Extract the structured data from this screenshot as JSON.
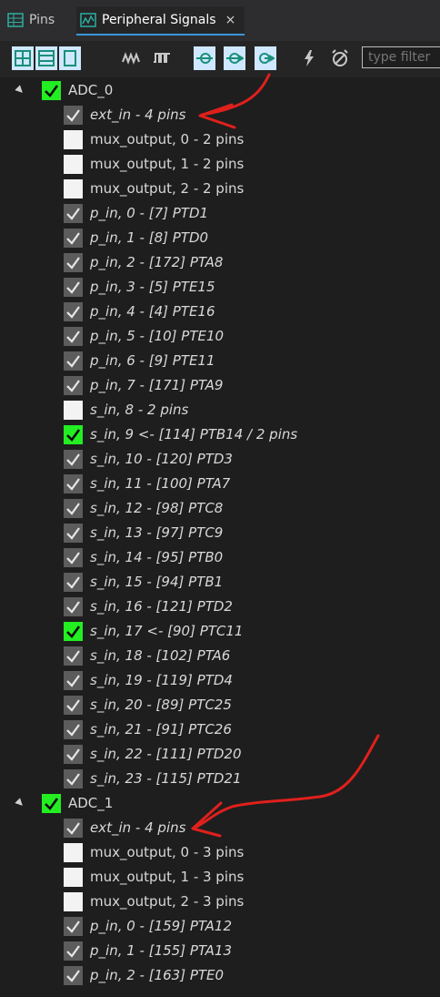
{
  "tabs": [
    {
      "label": "Pins"
    },
    {
      "label": "Peripheral Signals"
    }
  ],
  "toolbar": {
    "filter_placeholder": "type filter"
  },
  "tree": [
    {
      "name": "ADC_0",
      "items": [
        {
          "label": "ext_in - 4 pins",
          "state": "checked",
          "italic": true
        },
        {
          "label": "mux_output, 0 - 2 pins",
          "state": "unchecked",
          "italic": false
        },
        {
          "label": "mux_output, 1 - 2 pins",
          "state": "unchecked",
          "italic": false
        },
        {
          "label": "mux_output, 2 - 2 pins",
          "state": "unchecked",
          "italic": false
        },
        {
          "label": "p_in, 0 - [7] PTD1",
          "state": "checked",
          "italic": true
        },
        {
          "label": "p_in, 1 - [8] PTD0",
          "state": "checked",
          "italic": true
        },
        {
          "label": "p_in, 2 - [172] PTA8",
          "state": "checked",
          "italic": true
        },
        {
          "label": "p_in, 3 - [5] PTE15",
          "state": "checked",
          "italic": true
        },
        {
          "label": "p_in, 4 - [4] PTE16",
          "state": "checked",
          "italic": true
        },
        {
          "label": "p_in, 5 - [10] PTE10",
          "state": "checked",
          "italic": true
        },
        {
          "label": "p_in, 6 - [9] PTE11",
          "state": "checked",
          "italic": true
        },
        {
          "label": "p_in, 7 - [171] PTA9",
          "state": "checked",
          "italic": true
        },
        {
          "label": "s_in, 8 - 2 pins",
          "state": "unchecked",
          "italic": true
        },
        {
          "label": "s_in, 9 <- [114] PTB14 / 2 pins",
          "state": "green",
          "italic": true
        },
        {
          "label": "s_in, 10 - [120] PTD3",
          "state": "checked",
          "italic": true
        },
        {
          "label": "s_in, 11 - [100] PTA7",
          "state": "checked",
          "italic": true
        },
        {
          "label": "s_in, 12 - [98] PTC8",
          "state": "checked",
          "italic": true
        },
        {
          "label": "s_in, 13 - [97] PTC9",
          "state": "checked",
          "italic": true
        },
        {
          "label": "s_in, 14 - [95] PTB0",
          "state": "checked",
          "italic": true
        },
        {
          "label": "s_in, 15 - [94] PTB1",
          "state": "checked",
          "italic": true
        },
        {
          "label": "s_in, 16 - [121] PTD2",
          "state": "checked",
          "italic": true
        },
        {
          "label": "s_in, 17 <- [90] PTC11",
          "state": "green",
          "italic": true
        },
        {
          "label": "s_in, 18 - [102] PTA6",
          "state": "checked",
          "italic": true
        },
        {
          "label": "s_in, 19 - [119] PTD4",
          "state": "checked",
          "italic": true
        },
        {
          "label": "s_in, 20 - [89] PTC25",
          "state": "checked",
          "italic": true
        },
        {
          "label": "s_in, 21 - [91] PTC26",
          "state": "checked",
          "italic": true
        },
        {
          "label": "s_in, 22 - [111] PTD20",
          "state": "checked",
          "italic": true
        },
        {
          "label": "s_in, 23 - [115] PTD21",
          "state": "checked",
          "italic": true
        }
      ]
    },
    {
      "name": "ADC_1",
      "items": [
        {
          "label": "ext_in - 4 pins",
          "state": "checked",
          "italic": true
        },
        {
          "label": "mux_output, 0 - 3 pins",
          "state": "unchecked",
          "italic": false
        },
        {
          "label": "mux_output, 1 - 3 pins",
          "state": "unchecked",
          "italic": false
        },
        {
          "label": "mux_output, 2 - 3 pins",
          "state": "unchecked",
          "italic": false
        },
        {
          "label": "p_in, 0 - [159] PTA12",
          "state": "checked",
          "italic": true
        },
        {
          "label": "p_in, 1 - [155] PTA13",
          "state": "checked",
          "italic": true
        },
        {
          "label": "p_in, 2 - [163] PTE0",
          "state": "checked",
          "italic": true
        }
      ]
    }
  ],
  "colors": {
    "background": "#1e1e1e",
    "check_green": "#22ee22",
    "annotation_red": "#e0201c"
  }
}
